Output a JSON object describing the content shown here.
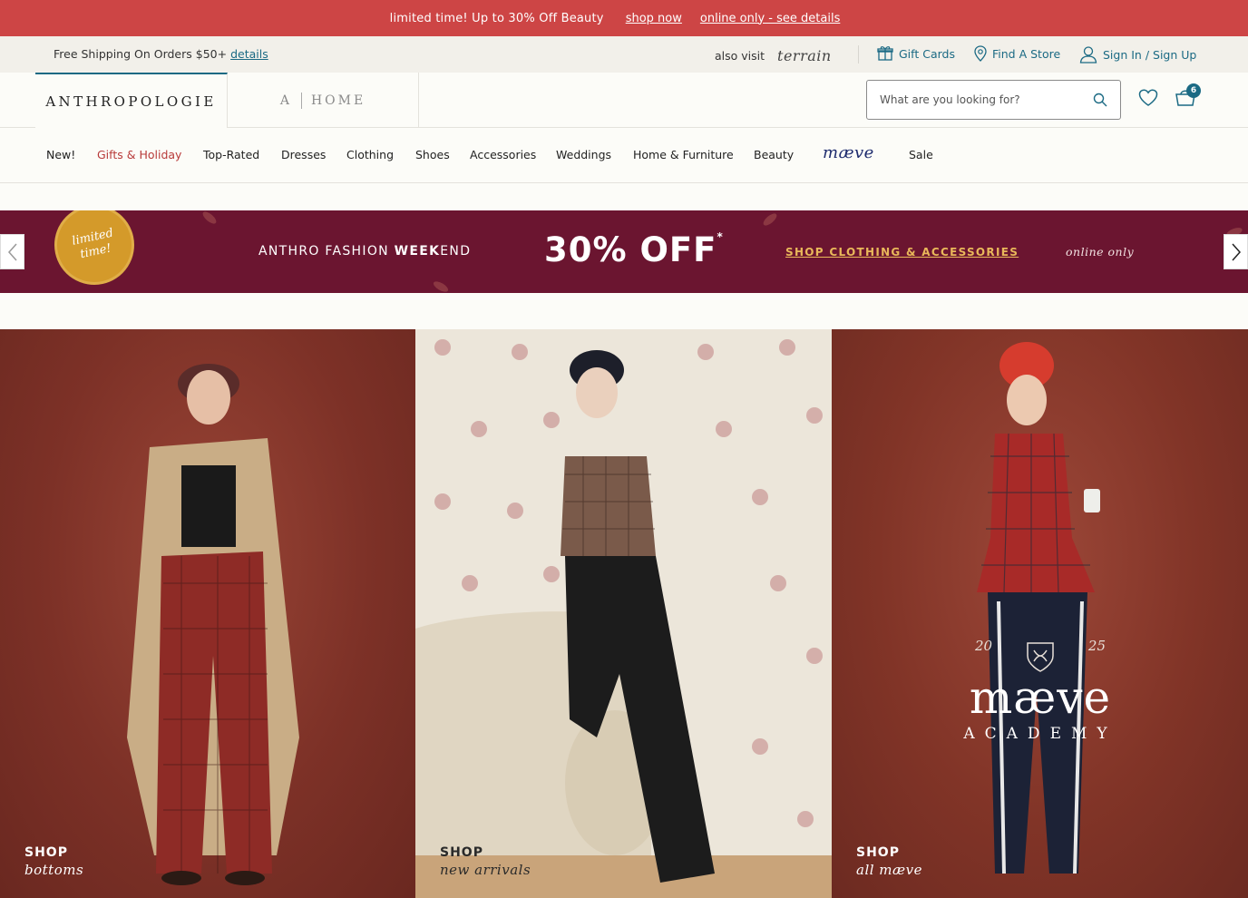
{
  "promo": {
    "message": "limited time! Up to 30% Off Beauty",
    "shop_now": "shop now",
    "details": "online only - see details"
  },
  "utility": {
    "shipping": "Free Shipping On Orders $50+",
    "shipping_details": "details",
    "also_visit": "also visit",
    "terrain": "terrain",
    "gift_cards": "Gift Cards",
    "find_store": "Find A Store",
    "sign_in": "Sign In / Sign Up"
  },
  "header": {
    "brand": "ANTHROPOLOGIE",
    "home_a": "A",
    "home_label": "HOME",
    "search_placeholder": "What are you looking for?",
    "basket_count": "6"
  },
  "nav": {
    "items": [
      "New!",
      "Gifts & Holiday",
      "Top-Rated",
      "Dresses",
      "Clothing",
      "Shoes",
      "Accessories",
      "Weddings",
      "Home & Furniture",
      "Beauty",
      "mæve",
      "Sale"
    ]
  },
  "banner": {
    "badge_line1": "limited",
    "badge_line2": "time!",
    "weekend_pre": "ANTHRO FASHION ",
    "weekend_bold": "WEEK",
    "weekend_post": "END",
    "offer": "30% OFF",
    "offer_mark": "*",
    "shop_cta": "SHOP CLOTHING & ACCESSORIES",
    "online": "online only"
  },
  "panels": [
    {
      "shop": "SHOP",
      "label": "bottoms"
    },
    {
      "shop": "SHOP",
      "label": "new arrivals"
    },
    {
      "shop": "SHOP",
      "label": "all mæve"
    }
  ],
  "maeve_academy": {
    "year_left": "20",
    "year_right": "25",
    "name": "mæve",
    "academy": "ACADEMY"
  },
  "colors": {
    "promo_bg": "#cd4545",
    "accent": "#1b6a84",
    "banner_bg": "#6b1530",
    "cta_gold": "#e9b85a"
  }
}
